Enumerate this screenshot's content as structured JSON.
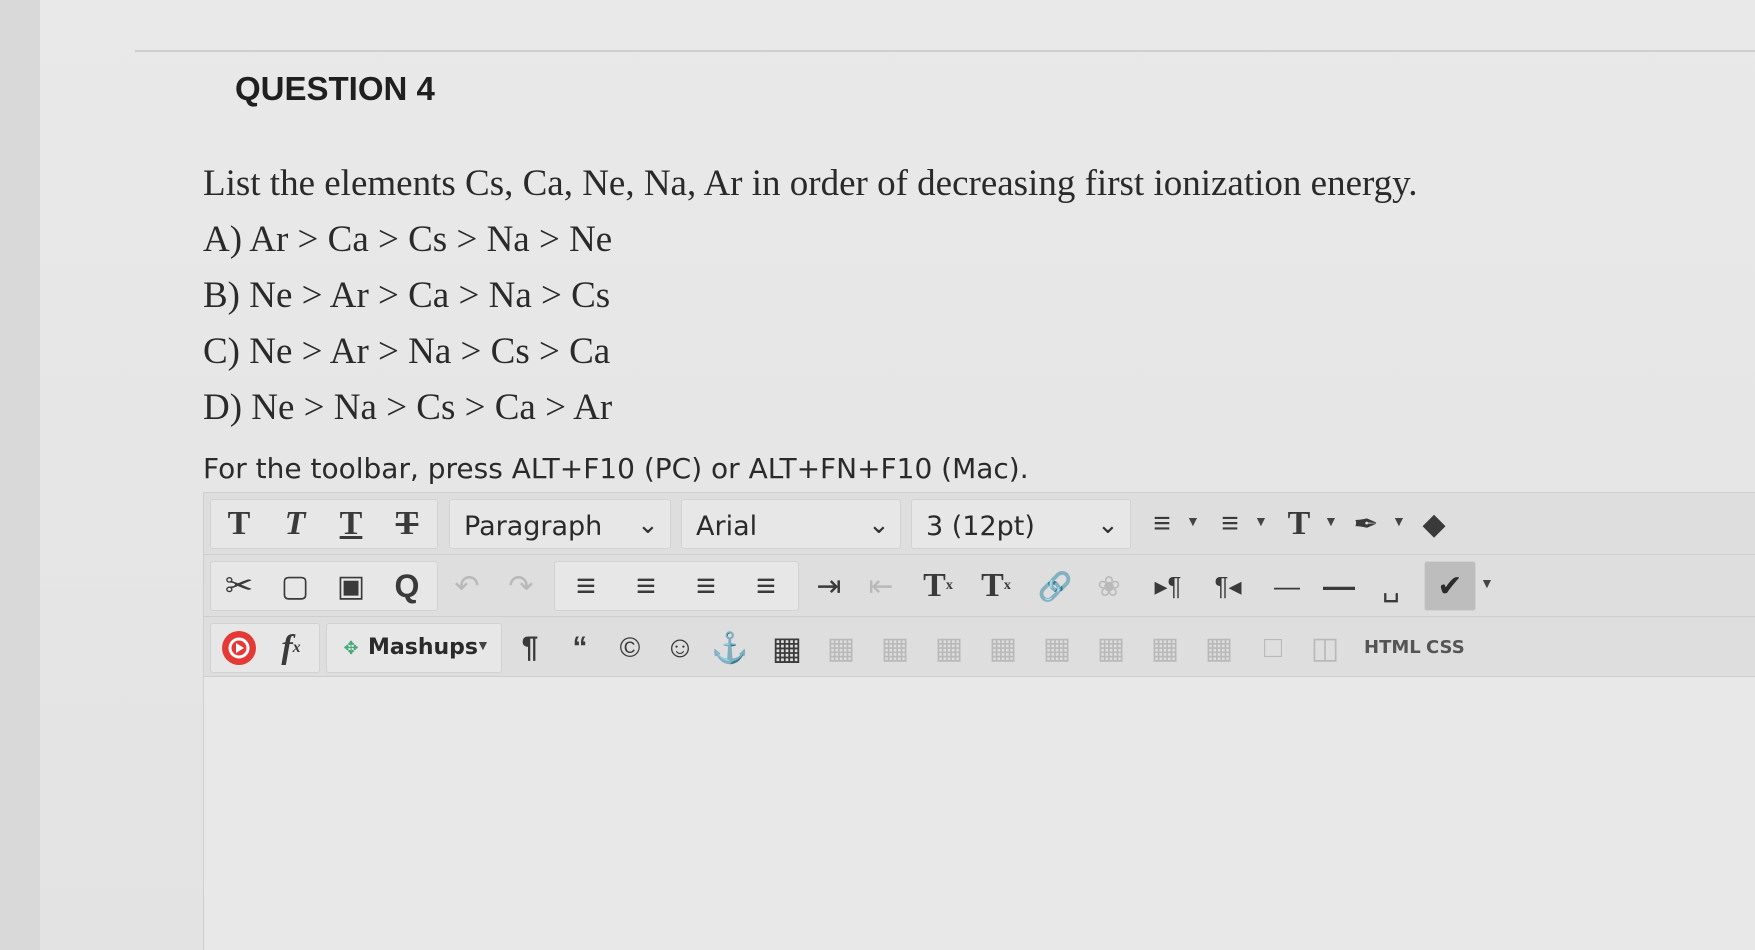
{
  "question": {
    "title": "QUESTION 4",
    "stem": "List the elements Cs, Ca, Ne, Na, Ar in order of decreasing first ionization energy.",
    "options": [
      "A) Ar > Ca > Cs > Na > Ne",
      "B) Ne > Ar > Ca > Na > Cs",
      "C) Ne > Ar > Na > Cs > Ca",
      "D) Ne > Na > Cs > Ca > Ar"
    ]
  },
  "editor": {
    "hint": "For the toolbar, press ALT+F10 (PC) or ALT+FN+F10 (Mac).",
    "format_select": "Paragraph",
    "font_select": "Arial",
    "size_select": "3 (12pt)",
    "mashups_label": "Mashups",
    "html_label": "HTML",
    "css_label": "CSS",
    "icons": {
      "bold": "T",
      "italic": "T",
      "underline": "T",
      "strikethrough": "T",
      "superscript": "T",
      "subscript": "T",
      "text_color": "T",
      "fx": "f"
    }
  }
}
